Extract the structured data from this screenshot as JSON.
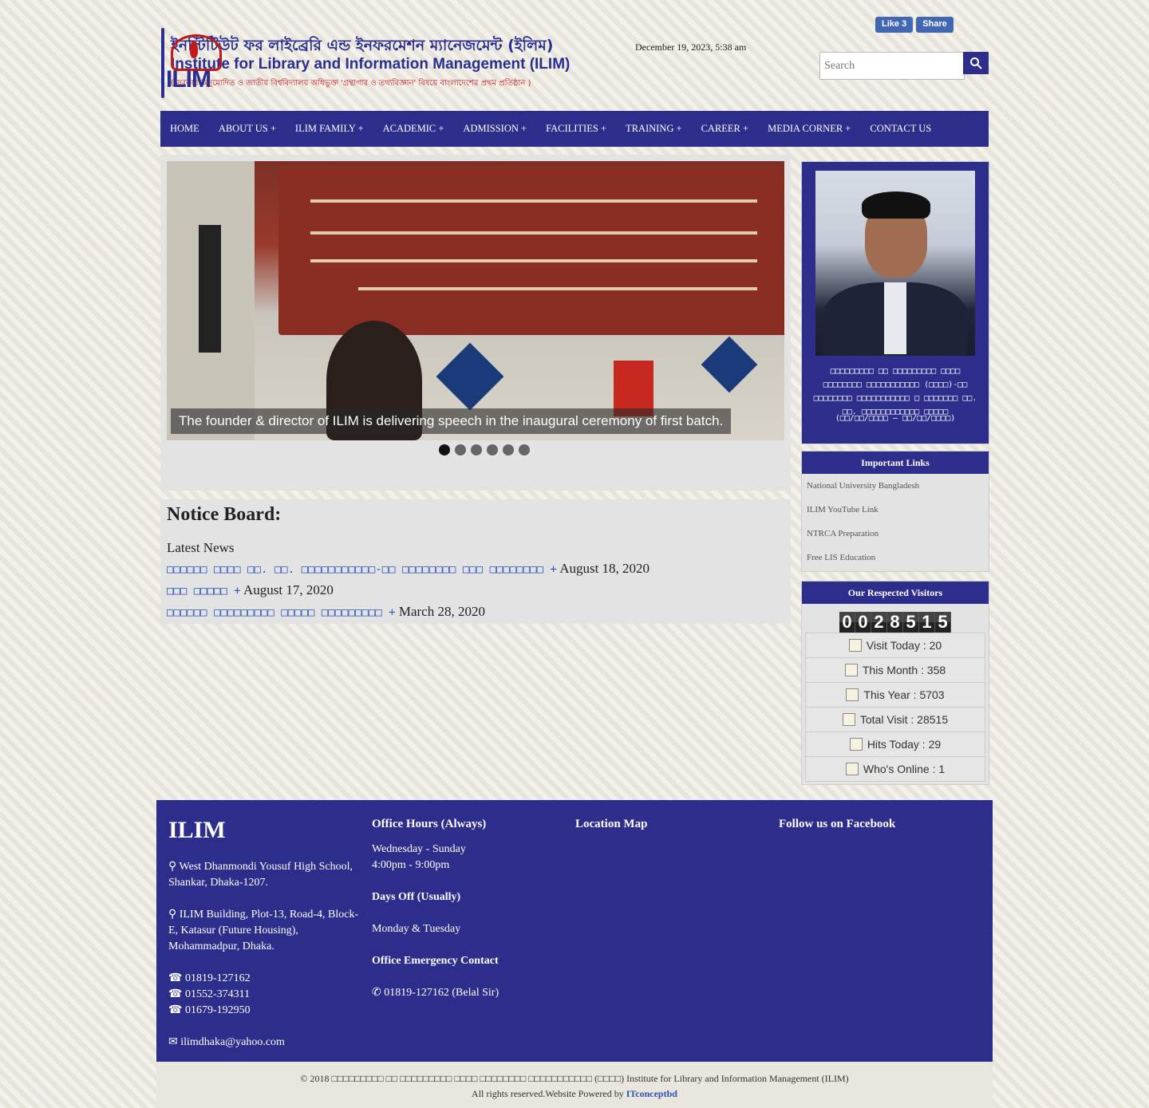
{
  "header": {
    "logo_bn": "ইনস্টিটিউট ফর লাইব্রেরি এন্ড ইনফরমেশন ম্যানেজমেন্ট (ইলিম)",
    "logo_en": "Institute for Library and Information Management (ILIM)",
    "logo_sub": "( সরকার অনুমোদিত ও জাতীয় বিশ্ববিদ্যালয় অধিভুক্ত 'গ্রন্থাগার ও তথ্যবিজ্ঞান' বিষয়ে বাংলাদেশের প্রথম প্রতিষ্ঠান )",
    "logo_emblem_text": "ILIM",
    "datetime": "December 19, 2023, 5:38 am",
    "fb_like": "Like 3",
    "fb_share": "Share",
    "search_placeholder": "Search"
  },
  "nav": [
    "HOME",
    "ABOUT US +",
    "ILIM FAMILY +",
    "ACADEMIC +",
    "ADMISSION +",
    "FACILITIES +",
    "TRAINING +",
    "CAREER +",
    "MEDIA CORNER +",
    "CONTACT US"
  ],
  "slider": {
    "caption": "The founder & director of ILIM is delivering speech in the inaugural ceremony of first batch.",
    "dot_count": 6,
    "active_dot": 0
  },
  "notice": {
    "title": "Notice Board:",
    "latest": "Latest News",
    "items": [
      {
        "text": "□□□□□□ □□□□ □□. □□. □□□□□□□□□□□-□□ □□□□□□□□ □□□ □□□□□□□□ +",
        "date": "August 18, 2020"
      },
      {
        "text": "□□□ □□□□□ +",
        "date": "August 17, 2020"
      },
      {
        "text": "□□□□□□ □□□□□□□□□ □□□□□ □□□□□□□□□ +",
        "date": "March 28, 2020"
      }
    ]
  },
  "founder": {
    "caption": "□□□□□□□□□ □□ □□□□□□□□□ □□□□ □□□□□□□□ □□□□□□□□□□□ (□□□□)-□□ □□□□□□□□ □□□□□□□□□□□ □ □□□□□□□ □□. □□. □□□□□□□□□□□□ □□□□□",
    "dates": "(□□/□□/□□□□ – □□/□□/□□□□)"
  },
  "important_links": {
    "title": "Important Links",
    "items": [
      "National University Bangladesh",
      "ILIM YouTube Link",
      "NTRCA Preparation",
      "Free LIS Education"
    ]
  },
  "visitors": {
    "title": "Our Respected Visitors",
    "digits": [
      "0",
      "0",
      "2",
      "8",
      "5",
      "1",
      "5"
    ],
    "stats": [
      "Visit Today : 20",
      "This Month : 358",
      "This Year : 5703",
      "Total Visit : 28515",
      "Hits Today : 29",
      "Who's Online : 1"
    ]
  },
  "footer": {
    "brand": "ILIM",
    "address1": "West Dhanmondi Yousuf High School, Shankar, Dhaka-1207.",
    "address2": "ILIM Building, Plot-13, Road-4, Block-E, Katasur (Future Housing), Mohammadpur, Dhaka.",
    "phones": [
      "01819-127162",
      "01552-374311",
      "01679-192950"
    ],
    "email": "ilimdhaka@yahoo.com",
    "hours_title": "Office Hours (Always)",
    "hours_days": "Wednesday - Sunday",
    "hours_time": "4:00pm - 9:00pm",
    "daysoff_title": "Days Off (Usually)",
    "daysoff": "Monday & Tuesday",
    "emergency_title": "Office Emergency Contact",
    "emergency": "01819-127162 (Belal Sir)",
    "map_title": "Location Map",
    "facebook_title": "Follow us on Facebook"
  },
  "copyright": {
    "line1": "© 2018 □□□□□□□□□ □□ □□□□□□□□□ □□□□ □□□□□□□□ □□□□□□□□□□□ (□□□□) Institute for Library and Information Management (ILIM)",
    "line2": "All rights reserved.Website Powered by",
    "powered": "ITconceptbd"
  }
}
